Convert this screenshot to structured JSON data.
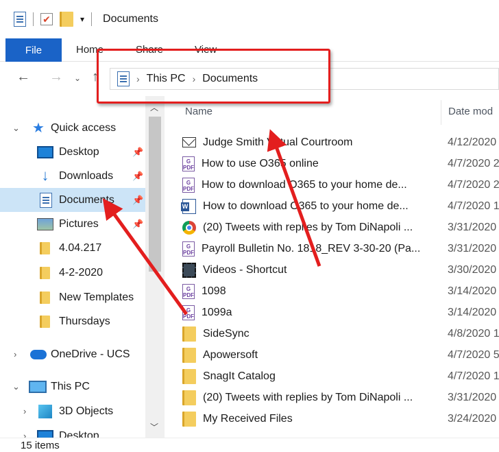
{
  "window": {
    "title": "Documents"
  },
  "ribbon": {
    "file": "File",
    "home": "Home",
    "share": "Share",
    "view": "View"
  },
  "address": {
    "crumbs": [
      "This PC",
      "Documents"
    ]
  },
  "nav": {
    "quick_access": "Quick access",
    "items": [
      "Desktop",
      "Downloads",
      "Documents",
      "Pictures",
      "4.04.217",
      "4-2-2020",
      "New Templates",
      "Thursdays"
    ],
    "onedrive": "OneDrive - UCS",
    "this_pc": "This PC",
    "objects_3d": "3D Objects",
    "desktop2": "Desktop"
  },
  "columns": {
    "name": "Name",
    "date": "Date mod"
  },
  "files": [
    {
      "name": "Judge Smith Virtual Courtroom",
      "date": "4/12/2020",
      "icon": "mail-icon"
    },
    {
      "name": "How to use O365 online",
      "date": "4/7/2020 2",
      "icon": "pdf-icon"
    },
    {
      "name": "How to download O365 to your home de...",
      "date": "4/7/2020 2",
      "icon": "pdf-icon"
    },
    {
      "name": "How to download O365 to your home de...",
      "date": "4/7/2020 1",
      "icon": "word-icon"
    },
    {
      "name": "(20) Tweets with replies by Tom DiNapoli ...",
      "date": "3/31/2020",
      "icon": "chrome-icon"
    },
    {
      "name": "Payroll Bulletin No. 1818_REV 3-30-20 (Pa...",
      "date": "3/31/2020",
      "icon": "pdf-icon"
    },
    {
      "name": "Videos - Shortcut",
      "date": "3/30/2020",
      "icon": "video-shortcut-icon"
    },
    {
      "name": "1098",
      "date": "3/14/2020",
      "icon": "pdf-icon"
    },
    {
      "name": "1099a",
      "date": "3/14/2020",
      "icon": "pdf-icon"
    },
    {
      "name": "SideSync",
      "date": "4/8/2020 1",
      "icon": "folder-icon"
    },
    {
      "name": "Apowersoft",
      "date": "4/7/2020 5",
      "icon": "folder-icon"
    },
    {
      "name": "SnagIt Catalog",
      "date": "4/7/2020 1",
      "icon": "folder-icon"
    },
    {
      "name": "(20) Tweets with replies by Tom DiNapoli ...",
      "date": "3/31/2020",
      "icon": "folder-icon"
    },
    {
      "name": "My Received Files",
      "date": "3/24/2020",
      "icon": "folder-icon"
    }
  ],
  "status": {
    "count": "15 items"
  },
  "colors": {
    "accent": "#1a63c7",
    "selection": "#cce4f7",
    "annotation": "#e31e1e"
  }
}
